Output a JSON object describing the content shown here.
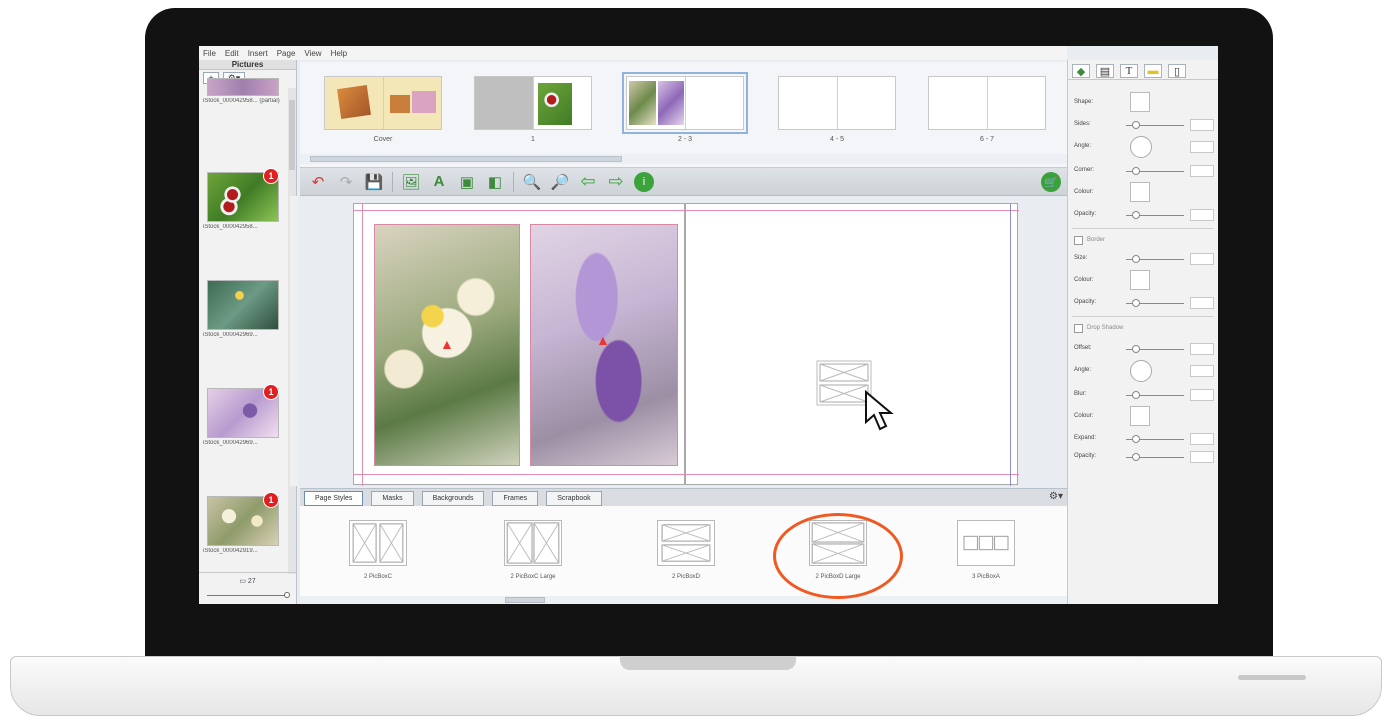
{
  "menu": [
    "File",
    "Edit",
    "Insert",
    "Page",
    "View",
    "Help"
  ],
  "pictures": {
    "title": "Pictures",
    "add_label": "+",
    "options_label": "⚙▾",
    "items": [
      {
        "label": "iStock_000042958... (partial)",
        "badge": ""
      },
      {
        "label": "iStock_000042958...",
        "badge": "1"
      },
      {
        "label": "iStock_000042969...",
        "badge": ""
      },
      {
        "label": "iStock_000042969...",
        "badge": "1"
      },
      {
        "label": "iStock_000042919...",
        "badge": "1"
      }
    ],
    "count": "27",
    "count_icon": "pictures-count-icon"
  },
  "spreads": [
    {
      "label": "Cover"
    },
    {
      "label": "1"
    },
    {
      "label": "2 - 3",
      "selected": true
    },
    {
      "label": "4 - 5"
    },
    {
      "label": "6 - 7"
    }
  ],
  "toolbar_icons": [
    "undo-icon",
    "redo-icon",
    "save-icon",
    "add-picture-icon",
    "add-text-icon",
    "add-shape-icon",
    "arrange-icon",
    "zoom-out-icon",
    "zoom-in-icon",
    "previous-page-icon",
    "next-page-icon",
    "help-icon",
    "cart-icon"
  ],
  "tabs": [
    {
      "label": "Page Styles",
      "active": true
    },
    {
      "label": "Masks"
    },
    {
      "label": "Backgrounds"
    },
    {
      "label": "Frames"
    },
    {
      "label": "Scrapbook"
    }
  ],
  "page_styles": [
    {
      "label": "2 PicBoxC"
    },
    {
      "label": "2 PicBoxC Large"
    },
    {
      "label": "2 PicBoxD"
    },
    {
      "label": "2 PicBoxD Large",
      "highlighted": true
    },
    {
      "label": "3 PicBoxA"
    }
  ],
  "properties": {
    "shape": "Shape:",
    "sides": "Sides:",
    "angle": "Angle:",
    "corner": "Corner:",
    "colour": "Colour:",
    "opacity": "Opacity:",
    "border": "Border",
    "size": "Size:",
    "border_colour": "Colour:",
    "border_opacity": "Opacity:",
    "drop_shadow": "Drop Shadow",
    "offset": "Offset:",
    "shadow_angle": "Angle:",
    "blur": "Blur:",
    "shadow_colour": "Colour:",
    "expand": "Expand:",
    "shadow_opacity": "Opacity:"
  },
  "colors": {
    "highlight": "#f05a22",
    "warning": "#e33333",
    "badge": "#e02020",
    "guide": "#e58ab0"
  }
}
